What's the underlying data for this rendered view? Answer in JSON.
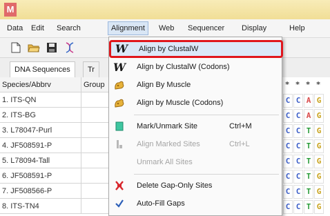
{
  "app": {
    "icon_letter": "M"
  },
  "menubar": {
    "items": [
      "Data",
      "Edit",
      "Search",
      "Alignment",
      "Web",
      "Sequencer",
      "Display",
      "Help"
    ],
    "open_index": 3
  },
  "toolbar": {
    "buttons": [
      "new-file-icon",
      "open-folder-icon",
      "save-disk-icon",
      "dna-helix-icon"
    ]
  },
  "tabs": [
    {
      "label": "DNA Sequences",
      "active": true
    },
    {
      "label": "Tr",
      "active": false
    }
  ],
  "table": {
    "headers": [
      "Species/Abbrv",
      "Group"
    ],
    "rows": [
      "1. ITS-QN",
      "2. ITS-BG",
      "3. L78047-Purl",
      "4. JF508591-P",
      "5. L78094-Tall",
      "6. JF508591-P",
      "7. JF508566-P",
      "8. ITS-TN4"
    ],
    "sequence_header_marks": [
      "*",
      "*",
      "*",
      "*"
    ],
    "sequences": [
      [
        "C",
        "C",
        "A",
        "G"
      ],
      [
        "C",
        "C",
        "A",
        "G"
      ],
      [
        "C",
        "C",
        "T",
        "G"
      ],
      [
        "C",
        "C",
        "T",
        "G"
      ],
      [
        "C",
        "C",
        "T",
        "G"
      ],
      [
        "C",
        "C",
        "T",
        "G"
      ],
      [
        "C",
        "C",
        "T",
        "G"
      ],
      [
        "C",
        "C",
        "T",
        "G"
      ]
    ],
    "base_colors": {
      "C": "#3b5ec8",
      "A": "#d94b4b",
      "T": "#2a9d3a",
      "G": "#c8a21a"
    }
  },
  "alignment_menu": {
    "items": [
      {
        "label": "Align by ClustalW",
        "shortcut": "",
        "icon": "clustalw-w-icon",
        "disabled": false,
        "highlighted": true
      },
      {
        "label": "Align by ClustalW (Codons)",
        "shortcut": "",
        "icon": "clustalw-w-icon",
        "disabled": false,
        "highlighted": false
      },
      {
        "label": "Align By Muscle",
        "shortcut": "",
        "icon": "muscle-arm-icon",
        "disabled": false,
        "highlighted": false
      },
      {
        "label": "Align by Muscle (Codons)",
        "shortcut": "",
        "icon": "muscle-arm-icon",
        "disabled": false,
        "highlighted": false
      },
      {
        "label": "Mark/Unmark Site",
        "shortcut": "Ctrl+M",
        "icon": "mark-site-icon",
        "disabled": false,
        "highlighted": false
      },
      {
        "label": "Align Marked Sites",
        "shortcut": "Ctrl+L",
        "icon": "align-marked-icon",
        "disabled": true,
        "highlighted": false
      },
      {
        "label": "Unmark All Sites",
        "shortcut": "",
        "icon": "",
        "disabled": true,
        "highlighted": false
      },
      {
        "label": "Delete Gap-Only Sites",
        "shortcut": "",
        "icon": "delete-gap-icon",
        "disabled": false,
        "highlighted": false
      },
      {
        "label": "Auto-Fill Gaps",
        "shortcut": "",
        "icon": "checkmark-icon",
        "disabled": false,
        "highlighted": false
      }
    ],
    "highlight_color": "#e0161c"
  }
}
